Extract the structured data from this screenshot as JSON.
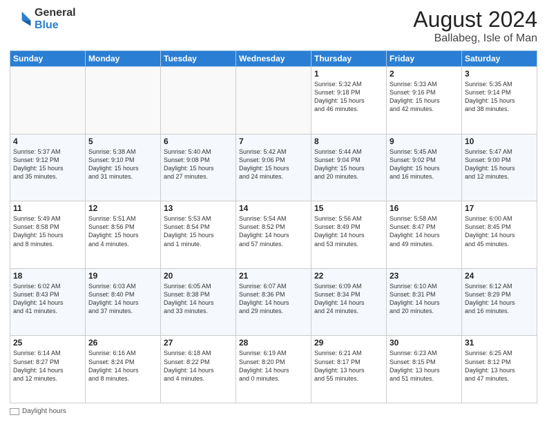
{
  "header": {
    "logo_general": "General",
    "logo_blue": "Blue",
    "month_year": "August 2024",
    "location": "Ballabeg, Isle of Man"
  },
  "calendar": {
    "days_of_week": [
      "Sunday",
      "Monday",
      "Tuesday",
      "Wednesday",
      "Thursday",
      "Friday",
      "Saturday"
    ],
    "weeks": [
      [
        {
          "day": "",
          "info": ""
        },
        {
          "day": "",
          "info": ""
        },
        {
          "day": "",
          "info": ""
        },
        {
          "day": "",
          "info": ""
        },
        {
          "day": "1",
          "info": "Sunrise: 5:32 AM\nSunset: 9:18 PM\nDaylight: 15 hours\nand 46 minutes."
        },
        {
          "day": "2",
          "info": "Sunrise: 5:33 AM\nSunset: 9:16 PM\nDaylight: 15 hours\nand 42 minutes."
        },
        {
          "day": "3",
          "info": "Sunrise: 5:35 AM\nSunset: 9:14 PM\nDaylight: 15 hours\nand 38 minutes."
        }
      ],
      [
        {
          "day": "4",
          "info": "Sunrise: 5:37 AM\nSunset: 9:12 PM\nDaylight: 15 hours\nand 35 minutes."
        },
        {
          "day": "5",
          "info": "Sunrise: 5:38 AM\nSunset: 9:10 PM\nDaylight: 15 hours\nand 31 minutes."
        },
        {
          "day": "6",
          "info": "Sunrise: 5:40 AM\nSunset: 9:08 PM\nDaylight: 15 hours\nand 27 minutes."
        },
        {
          "day": "7",
          "info": "Sunrise: 5:42 AM\nSunset: 9:06 PM\nDaylight: 15 hours\nand 24 minutes."
        },
        {
          "day": "8",
          "info": "Sunrise: 5:44 AM\nSunset: 9:04 PM\nDaylight: 15 hours\nand 20 minutes."
        },
        {
          "day": "9",
          "info": "Sunrise: 5:45 AM\nSunset: 9:02 PM\nDaylight: 15 hours\nand 16 minutes."
        },
        {
          "day": "10",
          "info": "Sunrise: 5:47 AM\nSunset: 9:00 PM\nDaylight: 15 hours\nand 12 minutes."
        }
      ],
      [
        {
          "day": "11",
          "info": "Sunrise: 5:49 AM\nSunset: 8:58 PM\nDaylight: 15 hours\nand 8 minutes."
        },
        {
          "day": "12",
          "info": "Sunrise: 5:51 AM\nSunset: 8:56 PM\nDaylight: 15 hours\nand 4 minutes."
        },
        {
          "day": "13",
          "info": "Sunrise: 5:53 AM\nSunset: 8:54 PM\nDaylight: 15 hours\nand 1 minute."
        },
        {
          "day": "14",
          "info": "Sunrise: 5:54 AM\nSunset: 8:52 PM\nDaylight: 14 hours\nand 57 minutes."
        },
        {
          "day": "15",
          "info": "Sunrise: 5:56 AM\nSunset: 8:49 PM\nDaylight: 14 hours\nand 53 minutes."
        },
        {
          "day": "16",
          "info": "Sunrise: 5:58 AM\nSunset: 8:47 PM\nDaylight: 14 hours\nand 49 minutes."
        },
        {
          "day": "17",
          "info": "Sunrise: 6:00 AM\nSunset: 8:45 PM\nDaylight: 14 hours\nand 45 minutes."
        }
      ],
      [
        {
          "day": "18",
          "info": "Sunrise: 6:02 AM\nSunset: 8:43 PM\nDaylight: 14 hours\nand 41 minutes."
        },
        {
          "day": "19",
          "info": "Sunrise: 6:03 AM\nSunset: 8:40 PM\nDaylight: 14 hours\nand 37 minutes."
        },
        {
          "day": "20",
          "info": "Sunrise: 6:05 AM\nSunset: 8:38 PM\nDaylight: 14 hours\nand 33 minutes."
        },
        {
          "day": "21",
          "info": "Sunrise: 6:07 AM\nSunset: 8:36 PM\nDaylight: 14 hours\nand 29 minutes."
        },
        {
          "day": "22",
          "info": "Sunrise: 6:09 AM\nSunset: 8:34 PM\nDaylight: 14 hours\nand 24 minutes."
        },
        {
          "day": "23",
          "info": "Sunrise: 6:10 AM\nSunset: 8:31 PM\nDaylight: 14 hours\nand 20 minutes."
        },
        {
          "day": "24",
          "info": "Sunrise: 6:12 AM\nSunset: 8:29 PM\nDaylight: 14 hours\nand 16 minutes."
        }
      ],
      [
        {
          "day": "25",
          "info": "Sunrise: 6:14 AM\nSunset: 8:27 PM\nDaylight: 14 hours\nand 12 minutes."
        },
        {
          "day": "26",
          "info": "Sunrise: 6:16 AM\nSunset: 8:24 PM\nDaylight: 14 hours\nand 8 minutes."
        },
        {
          "day": "27",
          "info": "Sunrise: 6:18 AM\nSunset: 8:22 PM\nDaylight: 14 hours\nand 4 minutes."
        },
        {
          "day": "28",
          "info": "Sunrise: 6:19 AM\nSunset: 8:20 PM\nDaylight: 14 hours\nand 0 minutes."
        },
        {
          "day": "29",
          "info": "Sunrise: 6:21 AM\nSunset: 8:17 PM\nDaylight: 13 hours\nand 55 minutes."
        },
        {
          "day": "30",
          "info": "Sunrise: 6:23 AM\nSunset: 8:15 PM\nDaylight: 13 hours\nand 51 minutes."
        },
        {
          "day": "31",
          "info": "Sunrise: 6:25 AM\nSunset: 8:12 PM\nDaylight: 13 hours\nand 47 minutes."
        }
      ]
    ]
  },
  "footer": {
    "daylight_label": "Daylight hours"
  }
}
